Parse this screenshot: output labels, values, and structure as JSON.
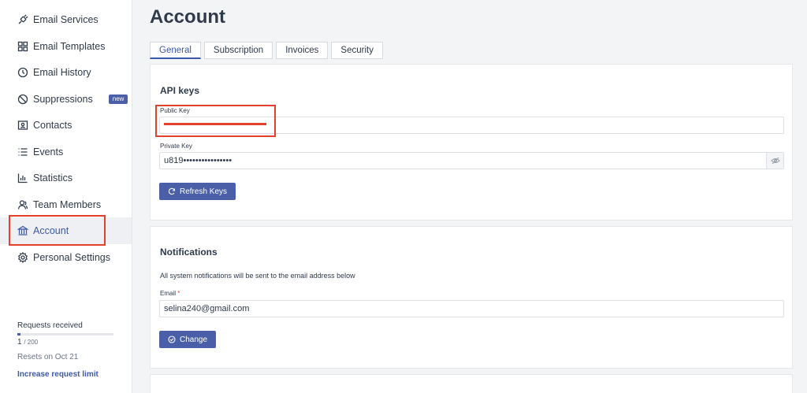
{
  "sidebar": {
    "items": [
      {
        "label": "Email Services",
        "icon": "plug-icon"
      },
      {
        "label": "Email Templates",
        "icon": "template-icon"
      },
      {
        "label": "Email History",
        "icon": "history-icon"
      },
      {
        "label": "Suppressions",
        "icon": "block-icon",
        "badge": "new"
      },
      {
        "label": "Contacts",
        "icon": "contacts-icon"
      },
      {
        "label": "Events",
        "icon": "list-icon"
      },
      {
        "label": "Statistics",
        "icon": "chart-icon"
      },
      {
        "label": "Team Members",
        "icon": "team-icon"
      },
      {
        "label": "Account",
        "icon": "bank-icon"
      },
      {
        "label": "Personal Settings",
        "icon": "gear-icon"
      }
    ],
    "active_item": "Account",
    "requests": {
      "label": "Requests received",
      "count": "1",
      "total": "/ 200",
      "fraction_used": 0.005,
      "reset": "Resets on Oct 21",
      "increase_link": "Increase request limit"
    }
  },
  "main": {
    "title": "Account",
    "tabs": [
      "General",
      "Subscription",
      "Invoices",
      "Security"
    ],
    "active_tab": "General",
    "api_keys": {
      "title": "API keys",
      "public_key_label": "Public Key",
      "public_key_value": "",
      "private_key_label": "Private Key",
      "private_key_value": "u819••••••••••••••••",
      "refresh_button": "Refresh Keys"
    },
    "notifications": {
      "title": "Notifications",
      "description": "All system notifications will be sent to the email address below",
      "email_label": "Email",
      "required_mark": "*",
      "email_value": "selina240@gmail.com",
      "change_button": "Change"
    }
  },
  "colors": {
    "accent": "#4a5fa8",
    "highlight": "#e2412b"
  }
}
